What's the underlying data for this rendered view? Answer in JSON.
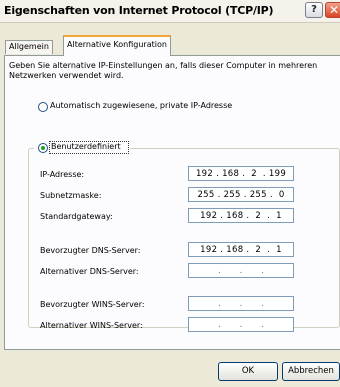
{
  "window": {
    "title": "Eigenschaften von Internet Protocol (TCP/IP)",
    "help_glyph": "?",
    "close_glyph": "✕"
  },
  "tabs": [
    {
      "label": "Allgemein",
      "active": false
    },
    {
      "label": "Alternative Konfiguration",
      "active": true
    }
  ],
  "description": "Geben Sie alternative IP-Einstellungen an, falls dieser Computer in mehreren Netzwerken verwendet wird.",
  "options": {
    "automatic": {
      "label": "Automatisch zugewiesene, private IP-Adresse",
      "selected": false
    },
    "custom": {
      "label": "Benutzerdefiniert",
      "selected": true
    }
  },
  "fields": {
    "ip_address": {
      "label": "IP-Adresse:",
      "value": "192 . 168 .  2  . 199"
    },
    "subnet_mask": {
      "label": "Subnetzmaske:",
      "value": "255 . 255 . 255 .  0"
    },
    "default_gateway": {
      "label": "Standardgateway:",
      "value": "192 . 168 .  2  .  1"
    },
    "preferred_dns": {
      "label": "Bevorzugter DNS-Server:",
      "value": "192 . 168 .  2  .  1"
    },
    "alternate_dns": {
      "label": "Alternativer DNS-Server:",
      "value": ""
    },
    "preferred_wins": {
      "label": "Bevorzugter WINS-Server:",
      "value": ""
    },
    "alternate_wins": {
      "label": "Alternativer WINS-Server:",
      "value": ""
    }
  },
  "empty_ip_placeholder": ".       .       .",
  "buttons": {
    "ok": "OK",
    "cancel": "Abbrechen"
  }
}
